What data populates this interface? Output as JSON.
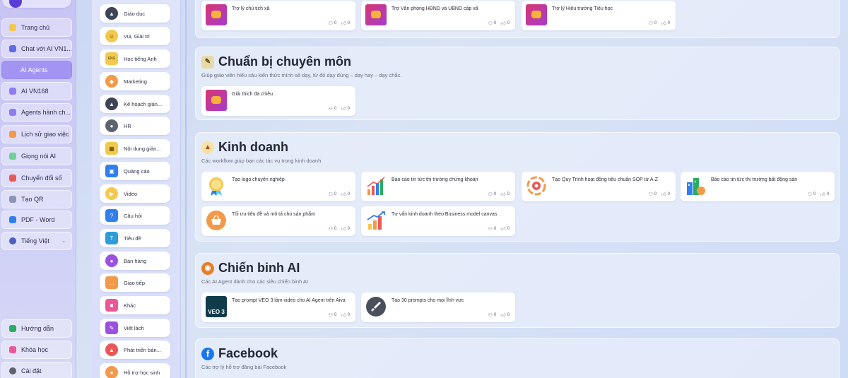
{
  "nav": {
    "items": [
      {
        "label": "Trang chủ",
        "icon": "home-icon",
        "color": "#f2c94c"
      },
      {
        "label": "Chat với AI VN1...",
        "icon": "chat-icon",
        "color": "#5b6ee1"
      },
      {
        "label": "AI Agents",
        "icon": "agents-icon",
        "color": "#a394f4"
      },
      {
        "label": "AI VN168",
        "icon": "sparkle-icon",
        "color": "#6f5cf0"
      },
      {
        "label": "Agents hành ch...",
        "icon": "sparkle-icon",
        "color": "#6f5cf0"
      },
      {
        "label": "Lịch sử giao việc",
        "icon": "clipboard-icon",
        "color": "#f2994a"
      },
      {
        "label": "Giọng nói AI",
        "icon": "mic-icon",
        "color": "#6fcf97"
      },
      {
        "label": "Chuyển đổi số",
        "icon": "switch-icon",
        "color": "#eb5757"
      },
      {
        "label": "Tạo QR",
        "icon": "qr-icon",
        "color": "#8c95b8"
      },
      {
        "label": "PDF - Word",
        "icon": "file-icon",
        "color": "#2f80ed"
      },
      {
        "label": "Tiếng Việt",
        "icon": "globe-icon",
        "color": "#4a5fc1"
      }
    ],
    "bottom": [
      {
        "label": "Hướng dẫn",
        "icon": "guide-icon",
        "color": "#27ae60"
      },
      {
        "label": "Khóa học",
        "icon": "course-icon",
        "color": "#eb5797"
      },
      {
        "label": "Cài đặt",
        "icon": "gear-icon",
        "color": "#5c6270"
      }
    ]
  },
  "categories": [
    {
      "label": "Giáo dục",
      "icon": "graduation-cap-icon",
      "color": "#3d4456"
    },
    {
      "label": "Vui, Giải trí",
      "icon": "smile-icon",
      "color": "#f2c94c"
    },
    {
      "label": "Học tiếng Anh",
      "icon": "eng-icon",
      "color": "#f2c94c"
    },
    {
      "label": "Marketing",
      "icon": "megaphone-icon",
      "color": "#f2994a"
    },
    {
      "label": "Kế hoạch giản...",
      "icon": "graduation-cap-icon",
      "color": "#3d4456"
    },
    {
      "label": "HR",
      "icon": "person-icon",
      "color": "#5c6270"
    },
    {
      "label": "Nội dung giản...",
      "icon": "calendar-icon",
      "color": "#f2c94c"
    },
    {
      "label": "Quảng cáo",
      "icon": "ads-icon",
      "color": "#2f80ed"
    },
    {
      "label": "Video",
      "icon": "play-icon",
      "color": "#f2c94c"
    },
    {
      "label": "Câu hỏi",
      "icon": "question-icon",
      "color": "#2f80ed"
    },
    {
      "label": "Tiêu đề",
      "icon": "title-icon",
      "color": "#2d9cdb"
    },
    {
      "label": "Bán hàng",
      "icon": "sale-icon",
      "color": "#9b51e0"
    },
    {
      "label": "Giao tiếp",
      "icon": "chat-bubble-icon",
      "color": "#f2994a"
    },
    {
      "label": "Khác",
      "icon": "box-icon",
      "color": "#eb5797"
    },
    {
      "label": "Viết lách",
      "icon": "pen-icon",
      "color": "#9b51e0"
    },
    {
      "label": "Phát triển bản...",
      "icon": "rocket-icon",
      "color": "#eb5757"
    },
    {
      "label": "Hỗ trợ học sinh",
      "icon": "students-icon",
      "color": "#f2994a"
    }
  ],
  "sections": {
    "top": {
      "cards": [
        {
          "title": "Trợ lý chủ tịch xã",
          "users": "0",
          "likes": "0"
        },
        {
          "title": "Trợ Văn phòng HĐND và UBND cấp xã",
          "users": "0",
          "likes": "0"
        },
        {
          "title": "Trợ lý Hiệu trưởng Tiểu học",
          "users": "0",
          "likes": "0"
        }
      ]
    },
    "chuanbi": {
      "title": "Chuẩn bị chuyên môn",
      "icon": "teacher-icon",
      "desc": "Giúp giáo viên hiểu sâu kiến thức mình sẽ dạy, từ đó dạy đúng – dạy hay – dạy chắc.",
      "cards": [
        {
          "title": "Giải thích đa chiều",
          "users": "0",
          "likes": "0"
        }
      ]
    },
    "kinhdoanh": {
      "title": "Kinh doanh",
      "icon": "rocket-icon",
      "desc": "Các workflow giúp bạn các tác vụ trong kinh doanh",
      "cards": [
        {
          "title": "Tạo logo chuyên nghiệp",
          "users": "0",
          "likes": "0",
          "thumb": "logo-badge-icon"
        },
        {
          "title": "Báo cáo tin tức thị trường chứng khoán",
          "users": "0",
          "likes": "0",
          "thumb": "bar-chart-icon"
        },
        {
          "title": "Tạo Quy Trình hoạt động tiêu chuẩn SOP từ A-Z",
          "users": "0",
          "likes": "0",
          "thumb": "gear-cycle-icon"
        },
        {
          "title": "Báo cáo tin tức thị trường bất động sản",
          "users": "0",
          "likes": "0",
          "thumb": "buildings-icon"
        },
        {
          "title": "Tối ưu tiêu đề và mô tả cho sản phẩm",
          "users": "0",
          "likes": "0",
          "thumb": "basket-icon"
        },
        {
          "title": "Tư vấn kinh doanh theo Business model canvas",
          "users": "0",
          "likes": "0",
          "thumb": "growth-chart-icon"
        }
      ]
    },
    "chienbinh": {
      "title": "Chiến binh AI",
      "icon": "warrior-icon",
      "desc": "Các AI Agent dành cho các siêu chiến binh AI",
      "cards": [
        {
          "title": "Tạo prompt VEO 3 làm video cho AI Agent trên Aiva",
          "users": "0",
          "likes": "0",
          "thumb": "veo3-icon",
          "thumb_text": "VEO 3"
        },
        {
          "title": "Tạo 30 prompts cho mọi lĩnh vực",
          "users": "0",
          "likes": "0",
          "thumb": "rocket-icon"
        }
      ]
    },
    "facebook": {
      "title": "Facebook",
      "icon": "facebook-icon",
      "desc": "Các trợ lý hỗ trợ đăng bài Facebook"
    }
  }
}
